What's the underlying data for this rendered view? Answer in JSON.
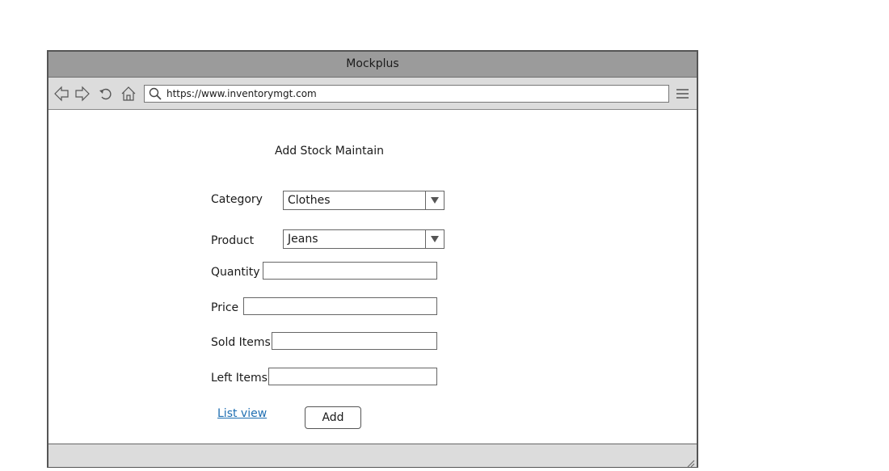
{
  "window": {
    "title": "Mockplus"
  },
  "toolbar": {
    "url": "https://www.inventorymgt.com",
    "icons": [
      "back-icon",
      "forward-icon",
      "reload-icon",
      "home-icon",
      "search-icon",
      "menu-icon"
    ]
  },
  "form": {
    "title": "Add Stock Maintain",
    "category": {
      "label": "Category",
      "value": "Clothes"
    },
    "product": {
      "label": "Product",
      "value": "Jeans"
    },
    "quantity": {
      "label": "Quantity",
      "value": ""
    },
    "price": {
      "label": "Price",
      "value": ""
    },
    "sold_items": {
      "label": "Sold Items",
      "value": ""
    },
    "left_items": {
      "label": "Left Items",
      "value": ""
    },
    "list_view_link": "List view",
    "add_button": "Add"
  },
  "colors": {
    "titlebar": "#9b9b9b",
    "toolbar": "#dcdcdc",
    "link": "#1f6fb2",
    "border": "#555555"
  }
}
